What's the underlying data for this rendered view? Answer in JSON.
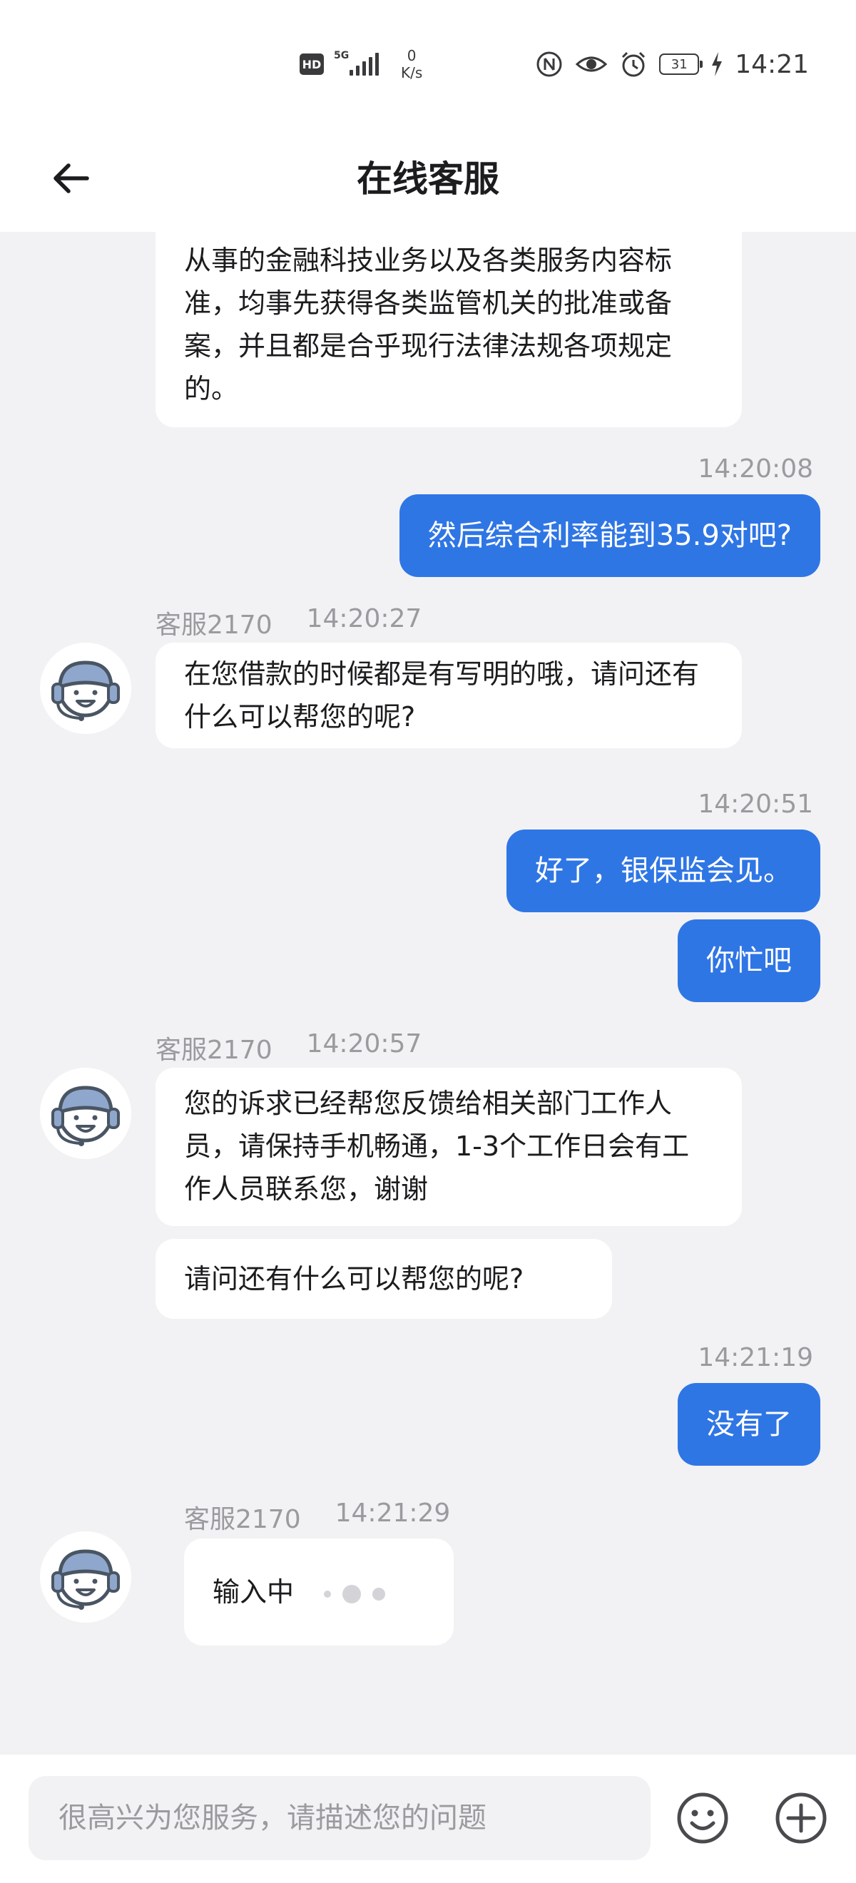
{
  "status_bar": {
    "hd_label": "HD",
    "network_type": "5G",
    "net_speed_value": "0",
    "net_speed_unit": "K/s",
    "icons": [
      "nfc-icon",
      "eye-icon",
      "alarm-icon"
    ],
    "battery_level": "31",
    "time": "14:21"
  },
  "header": {
    "back_icon": "back-arrow-icon",
    "title": "在线客服"
  },
  "messages": {
    "m1": {
      "sender": "agent",
      "text": "从事的金融科技业务以及各类服务内容标准，均事先获得各类监管机关的批准或备案，并且都是合乎现行法律法规各项规定的。"
    },
    "m2": {
      "sender": "user",
      "time": "14:20:08",
      "text": "然后综合利率能到35.9对吧?"
    },
    "m3": {
      "sender": "agent",
      "agent_name": "客服2170",
      "time": "14:20:27",
      "text": "在您借款的时候都是有写明的哦，请问还有什么可以帮您的呢?"
    },
    "m4": {
      "sender": "user",
      "time": "14:20:51",
      "text": "好了，银保监会见。"
    },
    "m5": {
      "sender": "user",
      "text": "你忙吧"
    },
    "m6": {
      "sender": "agent",
      "agent_name": "客服2170",
      "time": "14:20:57",
      "text": "您的诉求已经帮您反馈给相关部门工作人员，请保持手机畅通，1-3个工作日会有工作人员联系您，谢谢"
    },
    "m7": {
      "sender": "agent",
      "text": "请问还有什么可以帮您的呢?"
    },
    "m8": {
      "sender": "user",
      "time": "14:21:19",
      "text": "没有了"
    },
    "m9": {
      "sender": "agent",
      "agent_name": "客服2170",
      "time": "14:21:29",
      "text": "输入中",
      "typing": true
    }
  },
  "input_bar": {
    "placeholder": "很高兴为您服务，请描述您的问题",
    "emoji_icon": "emoji-icon",
    "add_icon": "add-icon"
  },
  "colors": {
    "user_bubble": "#2f76e5",
    "agent_bubble": "#ffffff",
    "chat_background": "#f2f2f4",
    "timestamp_text": "#9a9a9f"
  }
}
